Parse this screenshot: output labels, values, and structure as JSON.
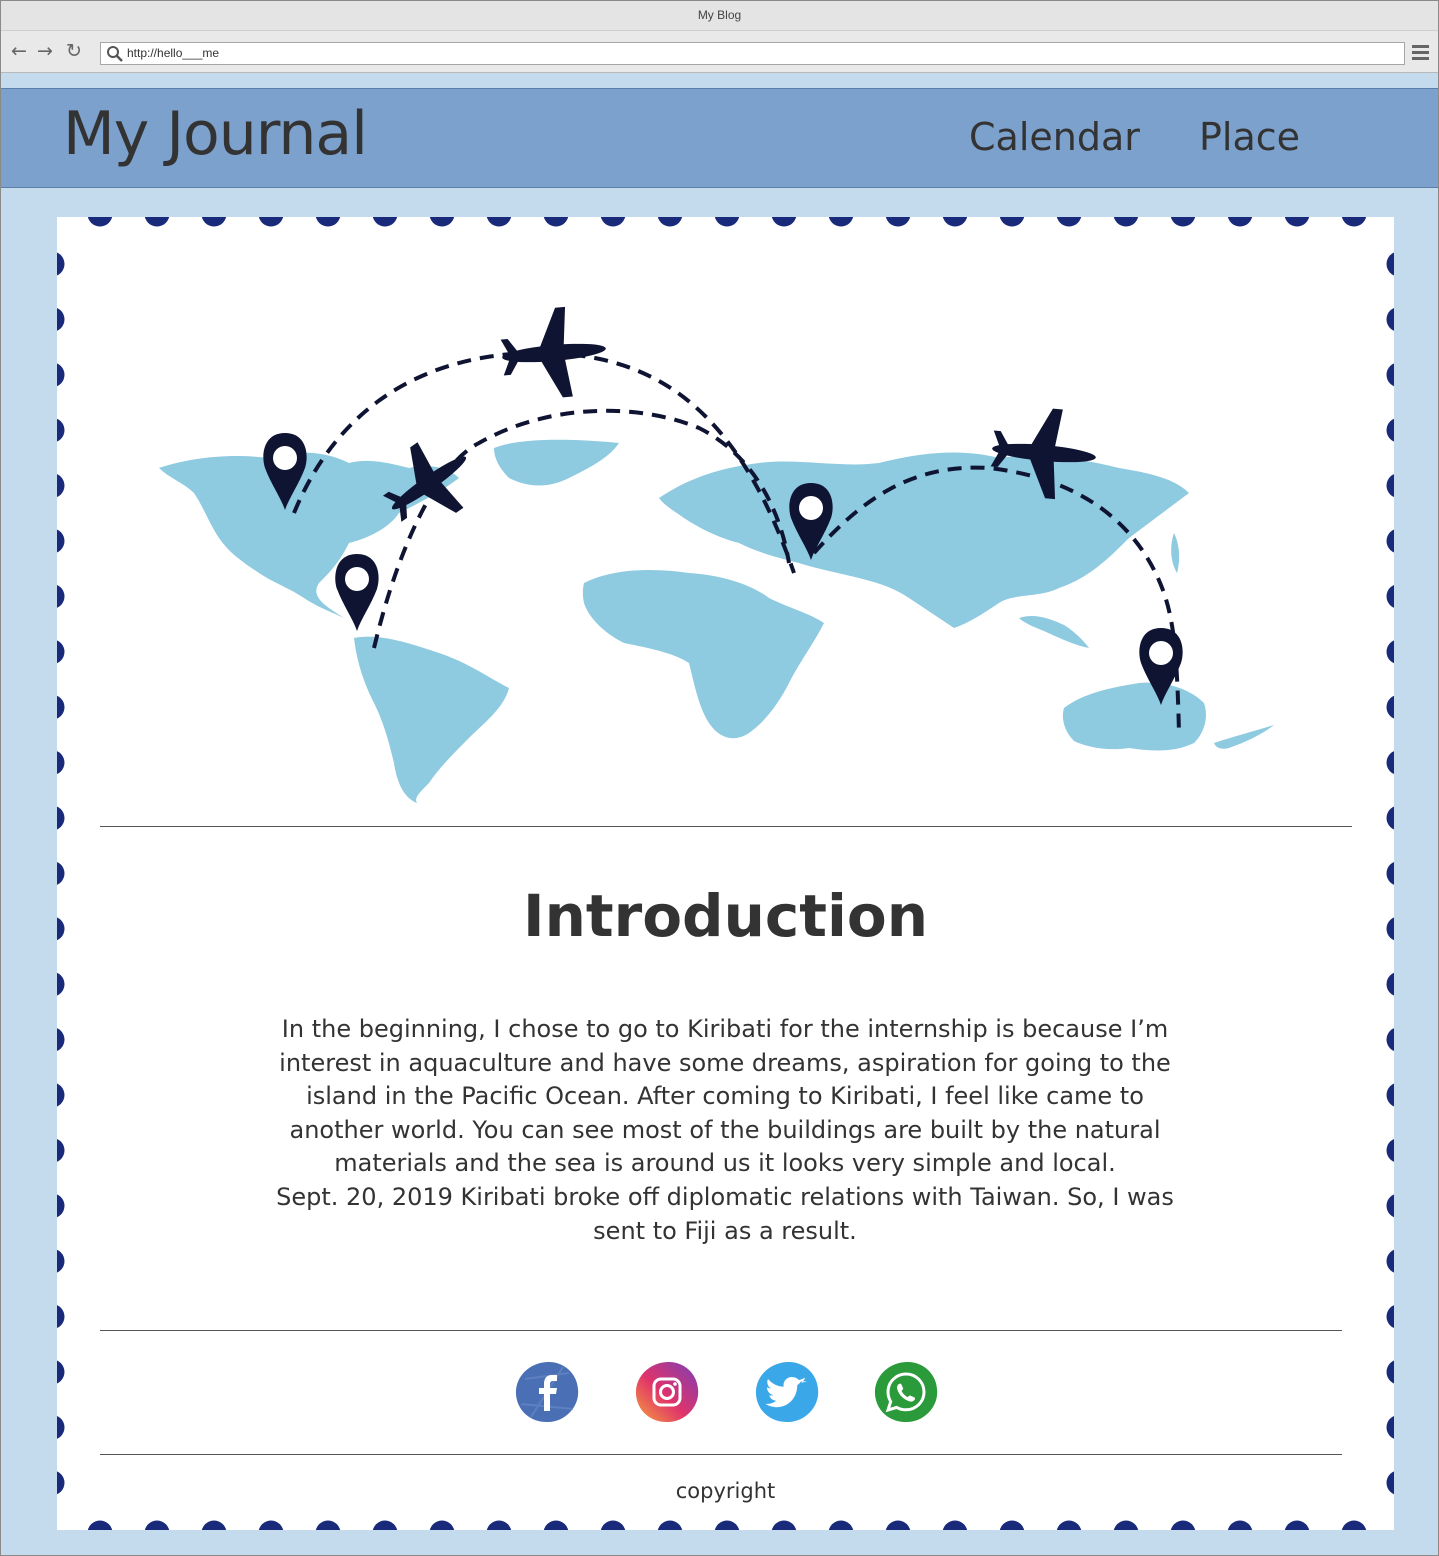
{
  "browser": {
    "window_title": "My Blog",
    "url": "http://hello___me"
  },
  "header": {
    "brand": "My Journal",
    "nav": [
      "Calendar",
      "Place"
    ],
    "background": "#7ca1cc"
  },
  "intro": {
    "title": "Introduction",
    "paragraphs": [
      "In the beginning, I chose to go to Kiribati for the internship is because I’m interest in aquaculture and have some dreams, aspiration for going to the island in the Pacific Ocean. After coming to Kiribati, I feel like came to another world. You can see most of the buildings are built by the natural materials and the sea is around us it looks very simple and local.",
      "Sept. 20, 2019 Kiribati broke off diplomatic relations with Taiwan. So, I was sent to Fiji as a result."
    ]
  },
  "socials": [
    {
      "name": "facebook",
      "color": "#4a6fb5"
    },
    {
      "name": "instagram",
      "color": "#c53b8a"
    },
    {
      "name": "twitter",
      "color": "#3aa8e8"
    },
    {
      "name": "whatsapp",
      "color": "#2b9a3a"
    }
  ],
  "footer": {
    "copyright": "copyright"
  },
  "colors": {
    "page_bg": "#c3dbec",
    "stamp_dots": "#1a2a7a",
    "map_land": "#8ecae0",
    "map_marks": "#0f1433"
  }
}
